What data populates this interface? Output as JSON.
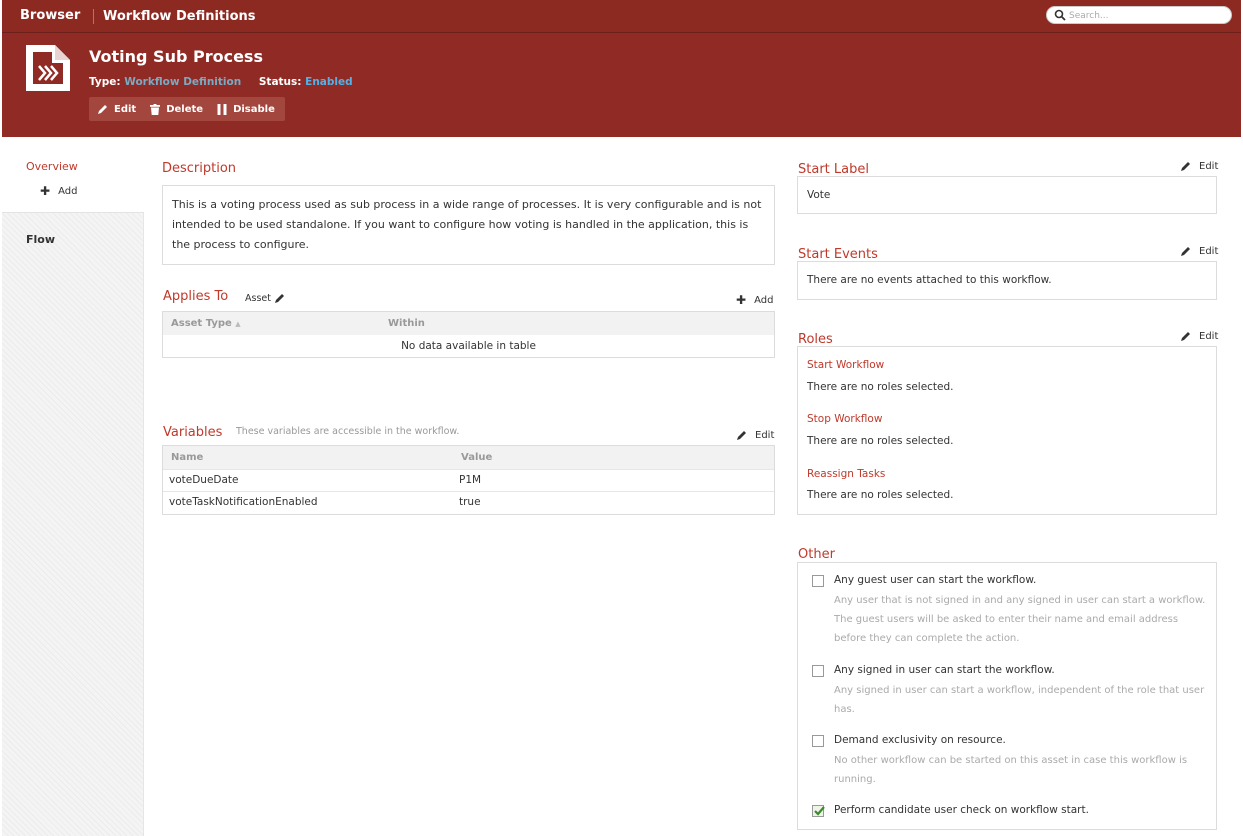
{
  "nav": {
    "brand": "Browser",
    "breadcrumb": "Workflow Definitions",
    "search_placeholder": "Search..."
  },
  "header": {
    "title": "Voting Sub Process",
    "type_label": "Type:",
    "type_value": "Workflow Definition",
    "status_label": "Status:",
    "status_value": "Enabled",
    "actions": {
      "edit": "Edit",
      "delete": "Delete",
      "disable": "Disable"
    }
  },
  "sidebar": {
    "overview": "Overview",
    "add": "Add",
    "flow": "Flow"
  },
  "description": {
    "title": "Description",
    "text": "This is a voting process used as sub process in a wide range of processes. It is very configurable and is not intended to be used standalone. If you want to configure how voting is handled in the application, this is the process to configure."
  },
  "applies_to": {
    "title": "Applies To",
    "tag": "Asset",
    "add_label": "Add",
    "columns": [
      "Asset Type",
      "Within"
    ],
    "empty": "No data available in table"
  },
  "variables": {
    "title": "Variables",
    "note": "These variables are accessible in the workflow.",
    "edit_label": "Edit",
    "columns": [
      "Name",
      "Value"
    ],
    "rows": [
      {
        "name": "voteDueDate",
        "value": "P1M"
      },
      {
        "name": "voteTaskNotificationEnabled",
        "value": "true"
      }
    ]
  },
  "start_label": {
    "title": "Start Label",
    "edit_label": "Edit",
    "value": "Vote"
  },
  "start_events": {
    "title": "Start Events",
    "edit_label": "Edit",
    "value": "There are no events attached to this workflow."
  },
  "roles": {
    "title": "Roles",
    "edit_label": "Edit",
    "items": [
      {
        "title": "Start Workflow",
        "value": "There are no roles selected."
      },
      {
        "title": "Stop Workflow",
        "value": "There are no roles selected."
      },
      {
        "title": "Reassign Tasks",
        "value": "There are no roles selected."
      }
    ]
  },
  "other": {
    "title": "Other",
    "options": [
      {
        "title": "Any guest user can start the workflow.",
        "checked": false,
        "desc": "Any user that is not signed in and any signed in user can start a workflow. The guest users will be asked to enter their name and email address before they can complete the action."
      },
      {
        "title": "Any signed in user can start the workflow.",
        "checked": false,
        "desc": "Any signed in user can start a workflow, independent of the role that user has."
      },
      {
        "title": "Demand exclusivity on resource.",
        "checked": false,
        "desc": "No other workflow can be started on this asset in case this workflow is running."
      },
      {
        "title": "Perform candidate user check on workflow start.",
        "checked": true,
        "desc": ""
      }
    ]
  },
  "colors": {
    "brand": "#8f2b24",
    "accent_red": "#c0392b",
    "type_link": "#7aa9c4",
    "status_link": "#54b1e8"
  }
}
